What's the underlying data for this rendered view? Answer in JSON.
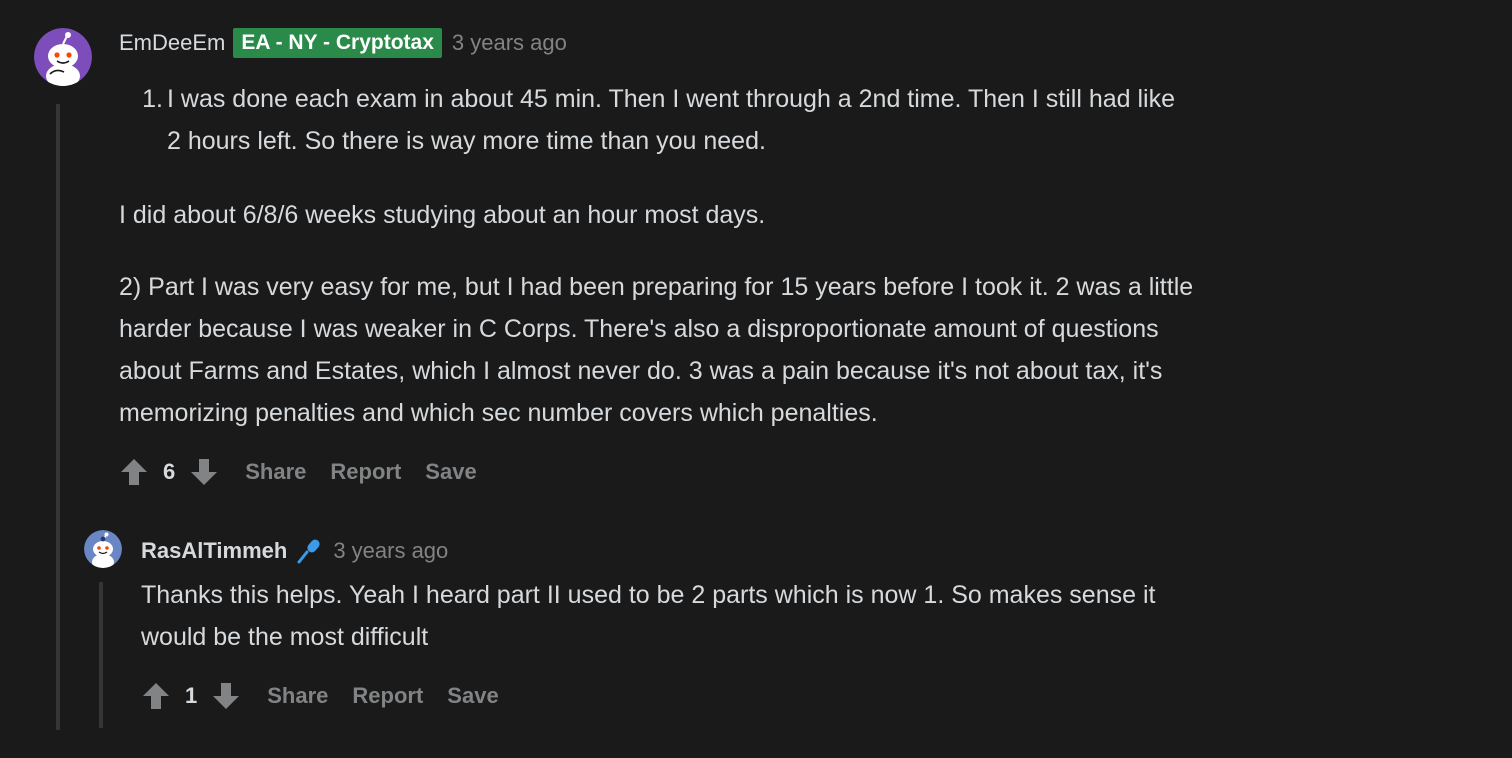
{
  "comment": {
    "username": "EmDeeEm",
    "flair": "EA - NY - Cryptotax",
    "timestamp": "3 years ago",
    "list_number": "1.",
    "list_item_line1": "I was done each exam in about 45 min. Then I went through a 2nd time. Then I still had like",
    "list_item_line2": "2 hours left. So there is way more time than you need.",
    "paragraph1": "I did about 6/8/6 weeks studying about an hour most days.",
    "paragraph2_line1": "2) Part I was very easy for me, but I had been preparing for 15 years before I took it. 2 was a little",
    "paragraph2_line2": "harder because I was weaker in C Corps. There's also a disproportionate amount of questions",
    "paragraph2_line3": "about Farms and Estates, which I almost never do. 3 was a pain because it's not about tax, it's",
    "paragraph2_line4": "memorizing penalties and which sec number covers which penalties.",
    "score": "6",
    "actions": {
      "share": "Share",
      "report": "Report",
      "save": "Save"
    },
    "avatar_color": "#7c4dbb"
  },
  "reply": {
    "username": "RasAlTimmeh",
    "timestamp": "3 years ago",
    "text_line1": "Thanks this helps. Yeah I heard part II used to be 2 parts which is now 1. So makes sense it",
    "text_line2": "would be the most difficult",
    "score": "1",
    "actions": {
      "share": "Share",
      "report": "Report",
      "save": "Save"
    },
    "avatar_color": "#6b86c4"
  },
  "colors": {
    "background": "#1a1a1b",
    "text": "#d7dadc",
    "muted": "#818384",
    "flair_bg": "#2a8a4a",
    "thread_line": "#343536",
    "mic_accent": "#3b9be8"
  },
  "icons": [
    "snoo-avatar-icon",
    "upvote-arrow-icon",
    "downvote-arrow-icon",
    "microphone-icon"
  ]
}
